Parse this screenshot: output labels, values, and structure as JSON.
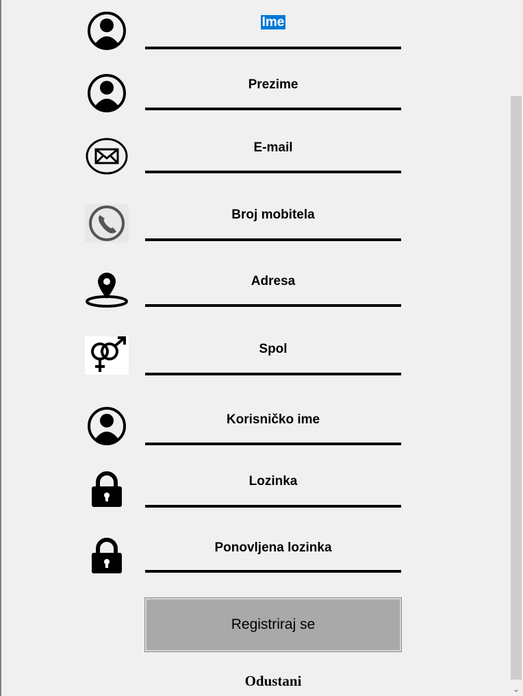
{
  "form": {
    "fields": [
      {
        "label": "Ime",
        "icon": "user-icon",
        "selected": true
      },
      {
        "label": "Prezime",
        "icon": "user-icon"
      },
      {
        "label": "E-mail",
        "icon": "envelope-icon"
      },
      {
        "label": "Broj mobitela",
        "icon": "phone-icon"
      },
      {
        "label": "Adresa",
        "icon": "location-pin-icon"
      },
      {
        "label": "Spol",
        "icon": "gender-icon"
      },
      {
        "label": "Korisničko ime",
        "icon": "user-icon"
      },
      {
        "label": "Lozinka",
        "icon": "lock-icon"
      },
      {
        "label": "Ponovljena lozinka",
        "icon": "lock-icon"
      }
    ],
    "register_label": "Registriraj se",
    "cancel_label": "Odustani"
  },
  "scrollbar": {
    "down_arrow": "⌄"
  },
  "colors": {
    "background": "#f0f0f0",
    "selection": "#0078d7",
    "button": "#a9a9a9",
    "underline": "#000000"
  }
}
